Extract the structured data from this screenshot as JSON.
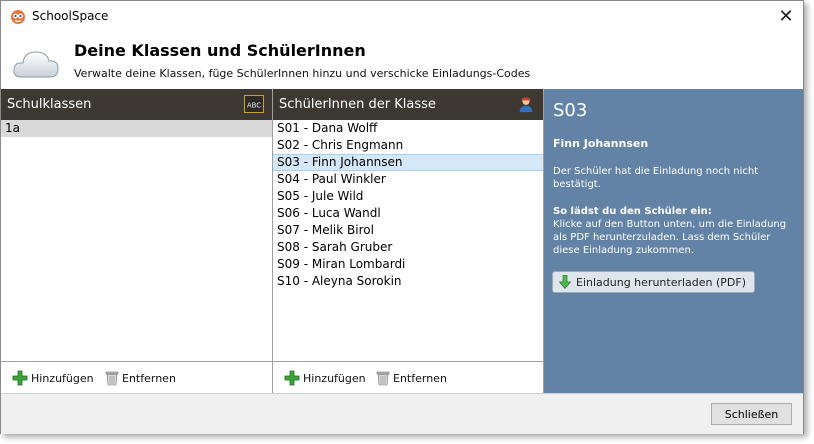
{
  "window": {
    "title": "SchoolSpace",
    "close_symbol": "✕"
  },
  "header": {
    "title": "Deine Klassen und SchülerInnen",
    "subtitle": "Verwalte deine Klassen, füge SchülerInnen hinzu und verschicke Einladungs-Codes",
    "icon": "cloud-icon"
  },
  "classes_panel": {
    "title": "Schulklassen",
    "icon": "abc-board-icon",
    "items": [
      "1a"
    ],
    "selected": "1a",
    "add_label": "Hinzufügen",
    "remove_label": "Entfernen"
  },
  "students_panel": {
    "title": "SchülerInnen der Klasse",
    "icon": "student-icon",
    "items": [
      "S01 - Dana Wolff",
      "S02 - Chris Engmann",
      "S03 - Finn Johannsen",
      "S04 - Paul Winkler",
      "S05 - Jule Wild",
      "S06 - Luca Wandl",
      "S07 - Melik Birol",
      "S08 - Sarah Gruber",
      "S09 - Miran Lombardi",
      "S10 - Aleyna Sorokin"
    ],
    "selected": "S03 - Finn Johannsen",
    "add_label": "Hinzufügen",
    "remove_label": "Entfernen"
  },
  "detail": {
    "id": "S03",
    "name": "Finn Johannsen",
    "status": "Der Schüler hat die Einladung noch nicht bestätigt.",
    "how_title": "So lädst du den Schüler ein:",
    "how_text": "Klicke auf den Button unten, um die Einladung als PDF herunterzuladen. Lass dem Schüler diese Einladung zukommen.",
    "download_label": "Einladung herunterladen (PDF)",
    "background": "#6383a6"
  },
  "footer": {
    "close_label": "Schließen"
  }
}
